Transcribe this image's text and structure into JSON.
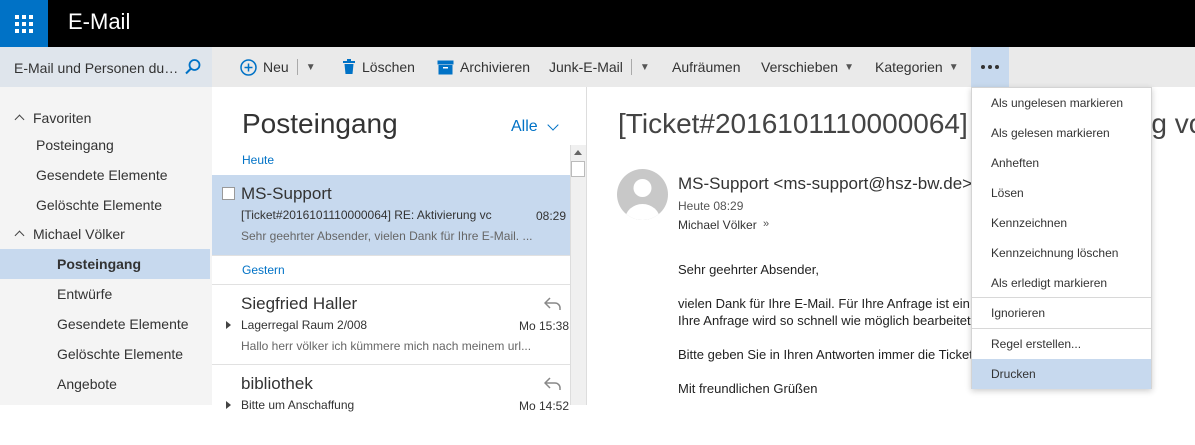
{
  "app": {
    "title": "E-Mail",
    "launcher_icon": "app-launcher-icon"
  },
  "search": {
    "text": "E-Mail und Personen durchsuchen",
    "icon": "search-icon"
  },
  "toolbar": {
    "new_label": "Neu",
    "delete_label": "Löschen",
    "archive_label": "Archivieren",
    "junk_label": "Junk-E-Mail",
    "sweep_label": "Aufräumen",
    "move_label": "Verschieben",
    "categories_label": "Kategorien",
    "more_icon": "ellipsis-icon"
  },
  "nav": {
    "favorites_label": "Favoriten",
    "favorites": [
      "Posteingang",
      "Gesendete Elemente",
      "Gelöschte Elemente"
    ],
    "account_label": "Michael Völker",
    "folders": [
      "Posteingang",
      "Entwürfe",
      "Gesendete Elemente",
      "Gelöschte Elemente",
      "Angebote"
    ]
  },
  "list": {
    "title": "Posteingang",
    "filter": "Alle",
    "groups": [
      "Heute",
      "Gestern"
    ],
    "messages": [
      {
        "sender": "MS-Support",
        "subject": "[Ticket#2016101110000064] RE: Aktivierung vc",
        "time": "08:29",
        "preview": "Sehr geehrter Absender,  vielen Dank für Ihre E-Mail. ..."
      },
      {
        "sender": "Siegfried Haller",
        "subject": "Lagerregal Raum 2/008",
        "time": "Mo 15:38",
        "preview": "Hallo herr völker ich kümmere mich nach meinem url..."
      },
      {
        "sender": "bibliothek",
        "subject": "Bitte um Anschaffung",
        "time": "Mo 14:52",
        "preview": ""
      }
    ]
  },
  "reading": {
    "subject": "[Ticket#2016101110000064] RE: Aktivierung von O",
    "from": "MS-Support <ms-support@hsz-bw.de>",
    "date": "Heute 08:29",
    "to": "Michael Völker",
    "body": [
      "Sehr geehrter Absender,",
      "vielen Dank für Ihre E-Mail. Für Ihre Anfrage ist ein",
      "Ihre Anfrage wird so schnell wie möglich bearbeitet",
      "Bitte geben Sie in Ihren Antworten immer die Ticket-Nummer [Ticket#xxxxxxx",
      "Mit freundlichen Grüßen"
    ]
  },
  "menu": {
    "items": [
      "Als ungelesen markieren",
      "Als gelesen markieren",
      "Anheften",
      "Lösen",
      "Kennzeichnen",
      "Kennzeichnung löschen",
      "Als erledigt markieren",
      "Ignorieren",
      "Regel erstellen...",
      "Drucken"
    ]
  }
}
